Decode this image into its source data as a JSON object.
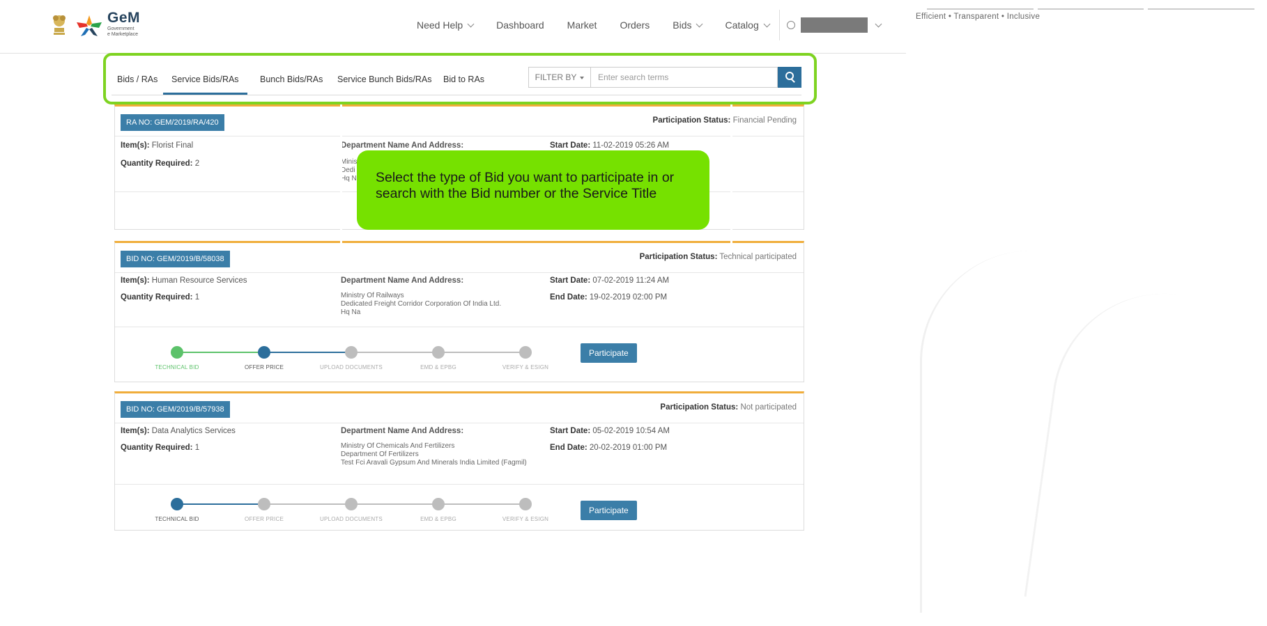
{
  "header": {
    "logo_title": "GeM",
    "logo_sub1": "Government",
    "logo_sub2": "e Marketplace",
    "nav": [
      "Need Help",
      "Dashboard",
      "Market",
      "Orders",
      "Bids",
      "Catalog"
    ],
    "nav_dropdown": [
      true,
      false,
      false,
      false,
      true,
      true
    ],
    "tagline": "Efficient • Transparent • Inclusive"
  },
  "tabs": {
    "items": [
      "Bids / RAs",
      "Service Bids/RAs",
      "Bunch Bids/RAs",
      "Service Bunch Bids/RAs",
      "Bid to RAs"
    ],
    "active_index": 1,
    "filter_label": "FILTER BY",
    "search_placeholder": "Enter search terms"
  },
  "callout": {
    "text": "Select the type of Bid you want to participate in or search with the Bid number or the Service Title"
  },
  "cards": [
    {
      "id_label": "RA NO: GEM/2019/RA/420",
      "status_label": "Participation Status:",
      "status_value": "Financial Pending",
      "items_label": "Item(s):",
      "items_value": "Florist Final",
      "qty_label": "Quantity Required:",
      "qty_value": "2",
      "dept_label": "Department Name And Address:",
      "dept_lines": [
        "Minis",
        "Dedi",
        "Hq N"
      ],
      "start_label": "Start Date:",
      "start_value": "11-02-2019 05:26 AM"
    },
    {
      "id_label": "BID NO: GEM/2019/B/58038",
      "status_label": "Participation Status:",
      "status_value": "Technical participated",
      "items_label": "Item(s):",
      "items_value": "Human Resource Services",
      "qty_label": "Quantity Required:",
      "qty_value": "1",
      "dept_label": "Department Name And Address:",
      "dept_lines": [
        "Ministry Of Railways",
        "Dedicated Freight Corridor Corporation Of India Ltd.",
        "Hq Na"
      ],
      "start_label": "Start Date:",
      "start_value": "07-02-2019 11:24 AM",
      "end_label": "End Date:",
      "end_value": "19-02-2019 02:00 PM",
      "progress_step": 2,
      "button": "Participate"
    },
    {
      "id_label": "BID NO: GEM/2019/B/57938",
      "status_label": "Participation Status:",
      "status_value": "Not participated",
      "items_label": "Item(s):",
      "items_value": "Data Analytics Services",
      "qty_label": "Quantity Required:",
      "qty_value": "1",
      "dept_label": "Department Name And Address:",
      "dept_lines": [
        "Ministry Of Chemicals And Fertilizers",
        "Department Of Fertilizers",
        "Test Fci Aravali Gypsum And Minerals India Limited (Fagmil)"
      ],
      "start_label": "Start Date:",
      "start_value": "05-02-2019 10:54 AM",
      "end_label": "End Date:",
      "end_value": "20-02-2019 01:00 PM",
      "progress_step": 1,
      "button": "Participate"
    }
  ],
  "steps": [
    "TECHNICAL BID",
    "OFFER PRICE",
    "UPLOAD DOCUMENTS",
    "EMD & EPBG",
    "VERIFY & ESIGN"
  ],
  "colors": {
    "primary": "#3b7ea8",
    "done": "#5cc26a",
    "current": "#2c6e9b",
    "pending": "#bdbdbd",
    "highlight": "#7ed321",
    "callout": "#76e100",
    "card_top": "#f0ad3a"
  }
}
